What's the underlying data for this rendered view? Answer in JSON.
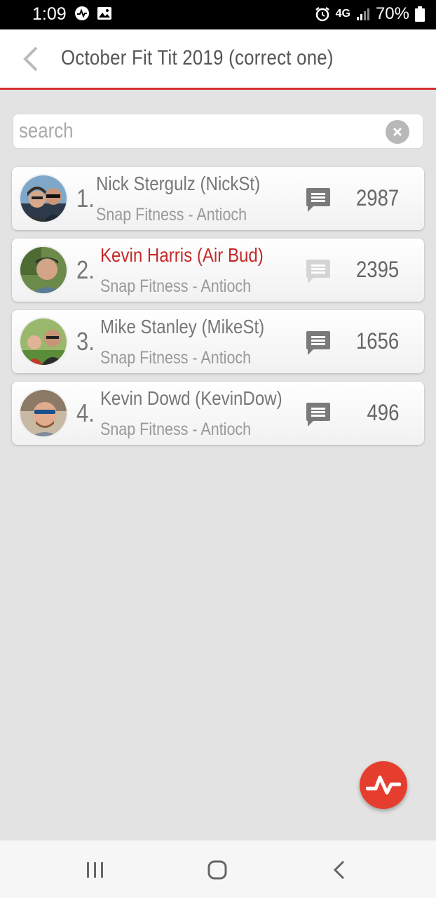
{
  "status_bar": {
    "time": "1:09",
    "network": "4G",
    "battery": "70%",
    "icons": [
      "activity-app-icon",
      "image-icon",
      "alarm-icon",
      "4g-lte-icon",
      "signal-icon",
      "battery-icon"
    ]
  },
  "header": {
    "title": "October Fit Tit 2019 (correct one)",
    "back_icon": "chevron-left-icon",
    "accent_color": "#d32f2f"
  },
  "search": {
    "placeholder": "search",
    "value": "",
    "clear_icon": "close-circle-icon"
  },
  "leaderboard": [
    {
      "rank": "1.",
      "name": "Nick Stergulz (NickSt)",
      "gym": "Snap Fitness - Antioch",
      "score": "2987",
      "highlight": false,
      "chat_active": true
    },
    {
      "rank": "2.",
      "name": "Kevin Harris (Air Bud)",
      "gym": "Snap Fitness - Antioch",
      "score": "2395",
      "highlight": true,
      "chat_active": false
    },
    {
      "rank": "3.",
      "name": "Mike Stanley (MikeSt)",
      "gym": "Snap Fitness - Antioch",
      "score": "1656",
      "highlight": false,
      "chat_active": true
    },
    {
      "rank": "4.",
      "name": "Kevin Dowd (KevinDow)",
      "gym": "Snap Fitness - Antioch",
      "score": "496",
      "highlight": false,
      "chat_active": true
    }
  ],
  "fab": {
    "icon": "activity-pulse-icon",
    "color": "#e53e2e"
  },
  "nav_bar": {
    "icons": [
      "recent-apps-icon",
      "home-icon",
      "back-icon"
    ]
  }
}
